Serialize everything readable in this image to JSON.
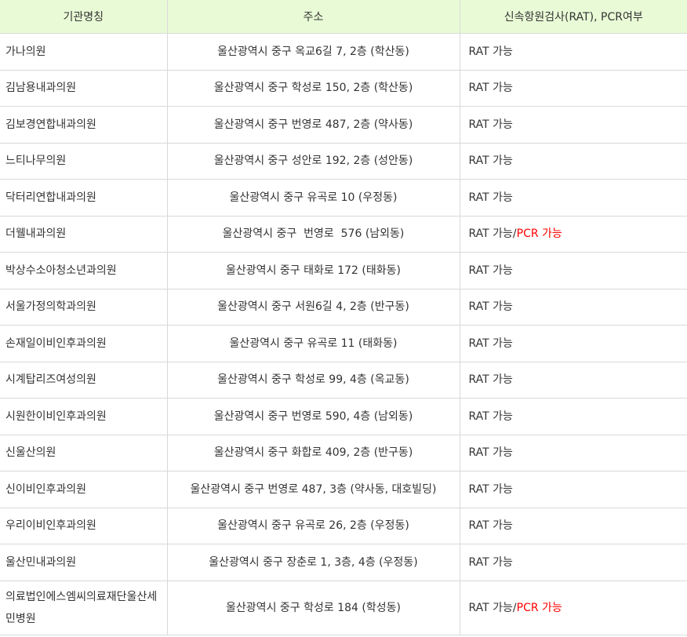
{
  "headers": [
    "기관명칭",
    "주소",
    "신속항원검사(RAT), PCR여부"
  ],
  "colors": {
    "header_bg": "#e9fbd6",
    "pcr": "#ff0000",
    "border": "#d9d9d9"
  },
  "rows": [
    {
      "name": "가나의원",
      "address": "울산광역시 중구 옥교6길 7, 2층 (학산동)",
      "rat": "RAT 가능",
      "pcr": ""
    },
    {
      "name": "김남용내과의원",
      "address": "울산광역시 중구 학성로 150, 2층 (학산동)",
      "rat": "RAT 가능",
      "pcr": ""
    },
    {
      "name": "김보경연합내과의원",
      "address": "울산광역시 중구 번영로 487, 2층 (약사동)",
      "rat": "RAT 가능",
      "pcr": ""
    },
    {
      "name": "느티나무의원",
      "address": "울산광역시 중구 성안로 192, 2층 (성안동)",
      "rat": "RAT 가능",
      "pcr": ""
    },
    {
      "name": "닥터리연합내과의원",
      "address": "울산광역시 중구 유곡로 10 (우정동)",
      "rat": "RAT 가능",
      "pcr": ""
    },
    {
      "name": "더웰내과의원",
      "address": "울산광역시 중구  번영로  576 (남외동)",
      "rat": "RAT 가능/",
      "pcr": "PCR 가능"
    },
    {
      "name": "박상수소아청소년과의원",
      "address": "울산광역시 중구 태화로 172 (태화동)",
      "rat": "RAT 가능",
      "pcr": ""
    },
    {
      "name": "서울가정의학과의원",
      "address": "울산광역시 중구 서원6길 4, 2층 (반구동)",
      "rat": "RAT 가능",
      "pcr": ""
    },
    {
      "name": "손재일이비인후과의원",
      "address": "울산광역시 중구 유곡로 11 (태화동)",
      "rat": "RAT 가능",
      "pcr": ""
    },
    {
      "name": "시계탑리즈여성의원",
      "address": "울산광역시 중구 학성로 99, 4층 (옥교동)",
      "rat": "RAT 가능",
      "pcr": ""
    },
    {
      "name": "시원한이비인후과의원",
      "address": "울산광역시 중구 번영로 590, 4층 (남외동)",
      "rat": "RAT 가능",
      "pcr": ""
    },
    {
      "name": "신울산의원",
      "address": "울산광역시 중구 화합로 409, 2층 (반구동)",
      "rat": "RAT 가능",
      "pcr": ""
    },
    {
      "name": "신이비인후과의원",
      "address": "울산광역시 중구 번영로 487, 3층 (약사동, 대호빌딩)",
      "rat": "RAT 가능",
      "pcr": ""
    },
    {
      "name": "우리이비인후과의원",
      "address": "울산광역시 중구 유곡로 26, 2층 (우정동)",
      "rat": "RAT 가능",
      "pcr": ""
    },
    {
      "name": "울산민내과의원",
      "address": "울산광역시 중구 장춘로 1, 3층, 4층 (우정동)",
      "rat": "RAT 가능",
      "pcr": ""
    },
    {
      "name": "의료법인에스엠씨의료재단울산세민병원",
      "address": "울산광역시 중구 학성로 184 (학성동)",
      "rat": "RAT 가능/",
      "pcr": "PCR 가능"
    }
  ]
}
